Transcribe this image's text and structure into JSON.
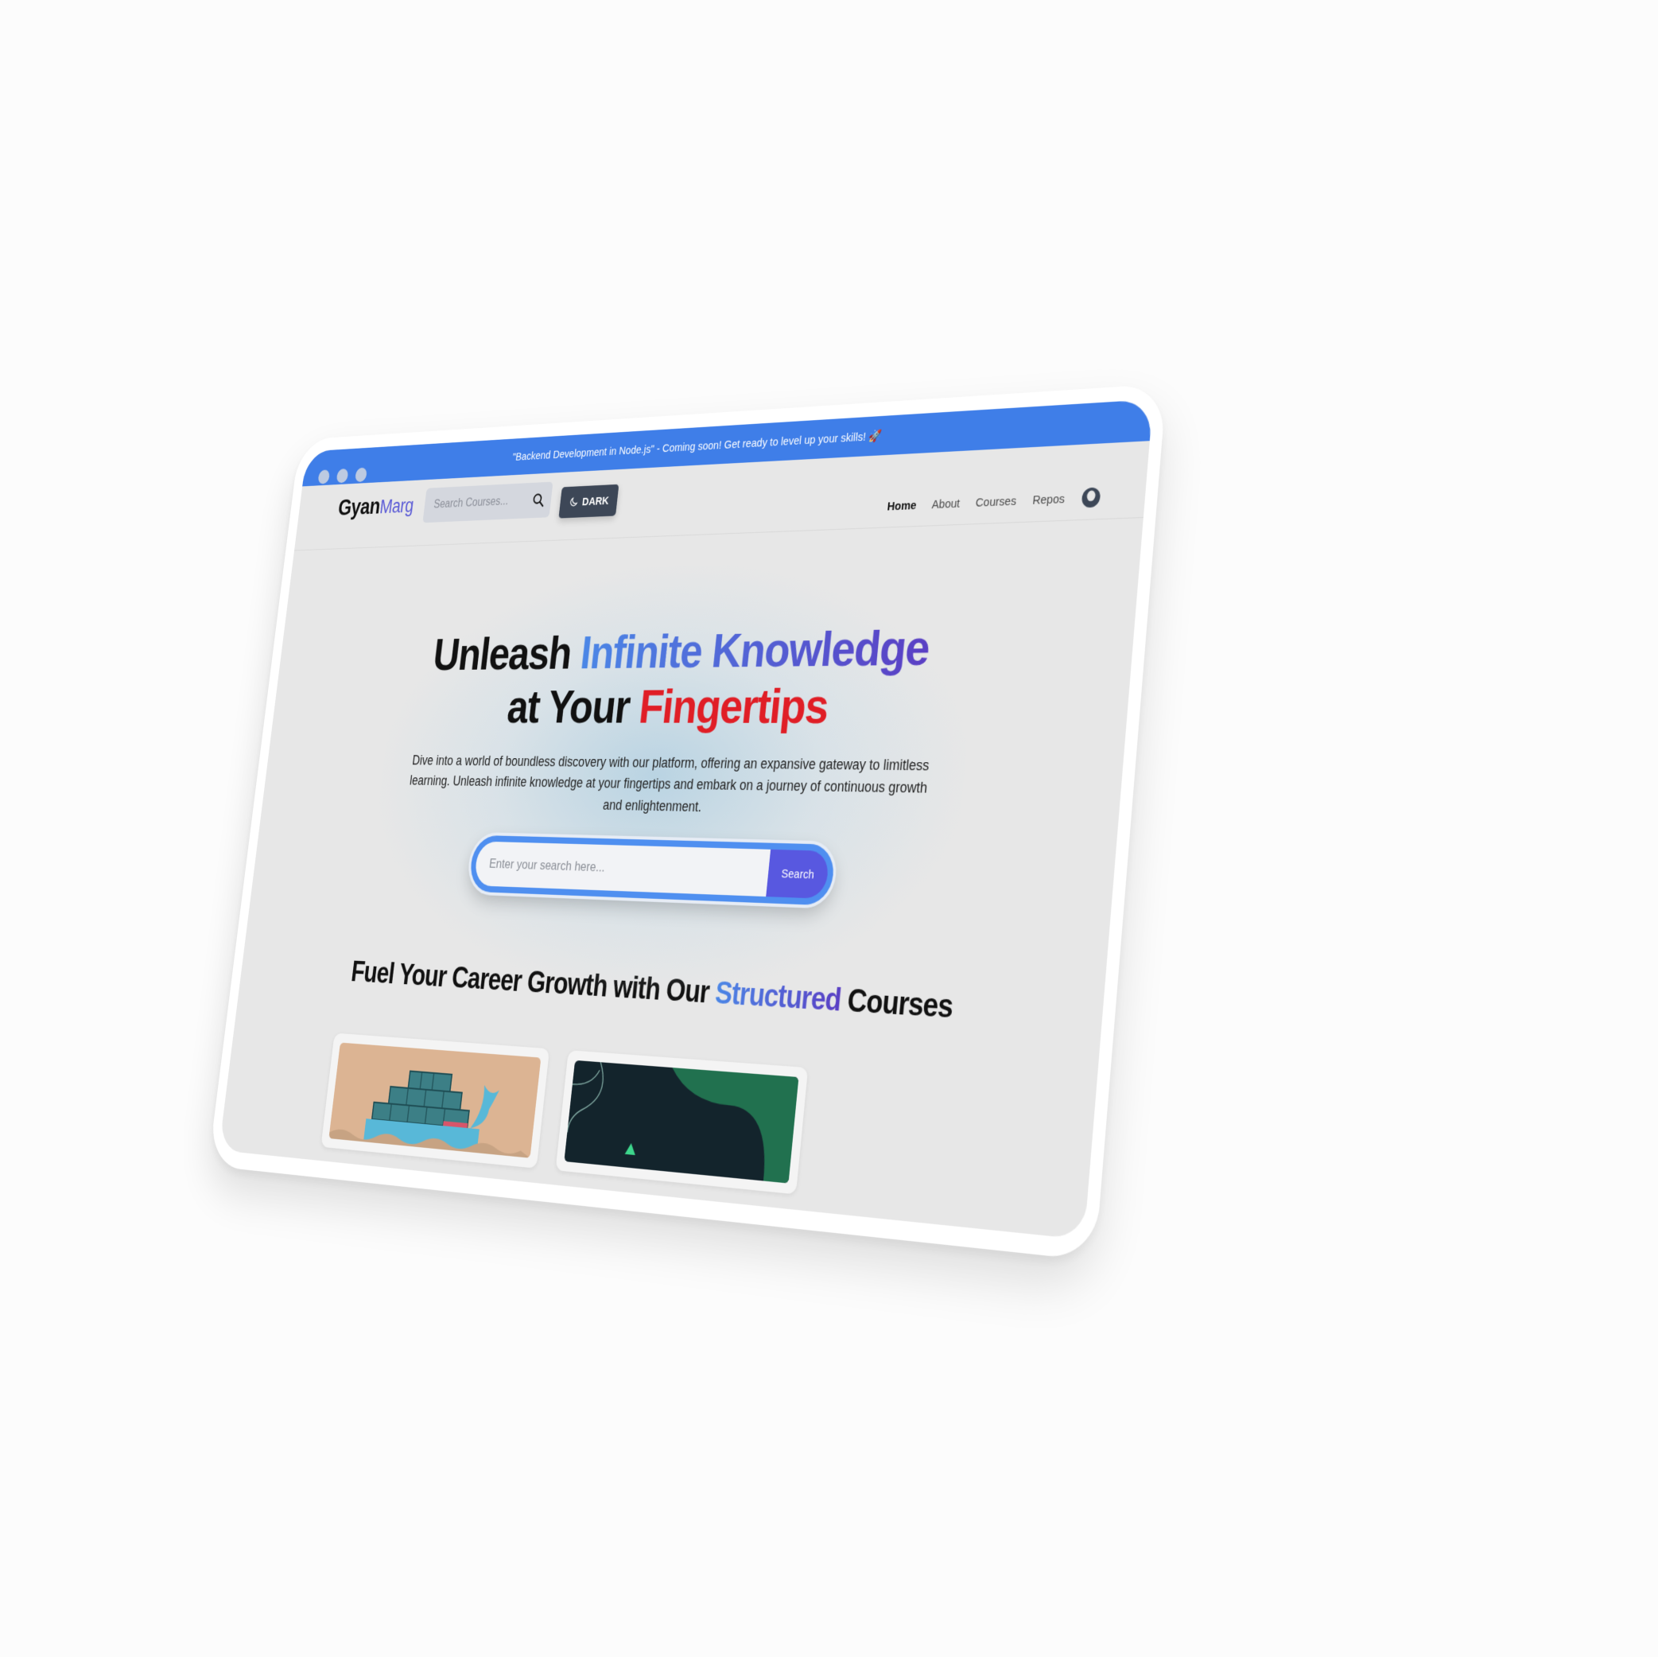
{
  "announcement": "\"Backend Development in Node.js\" - Coming soon! Get ready to level up your skills! 🚀",
  "brand": {
    "first": "Gyan",
    "second": "Marg"
  },
  "navbar": {
    "search_placeholder": "Search Courses...",
    "theme_button": "DARK",
    "links": [
      "Home",
      "About",
      "Courses",
      "Repos"
    ],
    "active_link": "Home"
  },
  "hero": {
    "headline_part1": "Unleash",
    "headline_highlight1": "Infinite Knowledge",
    "headline_part2": "at Your",
    "headline_highlight2": "Fingertips",
    "description": "Dive into a world of boundless discovery with our platform, offering an expansive gateway to limitless learning. Unleash infinite knowledge at your fingertips and embark on a journey of continuous growth and enlightenment.",
    "search_placeholder": "Enter your search here...",
    "search_button": "Search"
  },
  "courses_section": {
    "title_part1": "Fuel Your Career Growth with Our",
    "title_highlight": "Structured",
    "title_part2": "Courses"
  },
  "colors": {
    "announcement_bar": "#3f7ee8",
    "accent_purple": "#5858e0",
    "accent_red": "#e01e26",
    "page_background": "#e7e7e7"
  },
  "icons": [
    "search-icon",
    "moon-icon",
    "avatar-icon"
  ]
}
